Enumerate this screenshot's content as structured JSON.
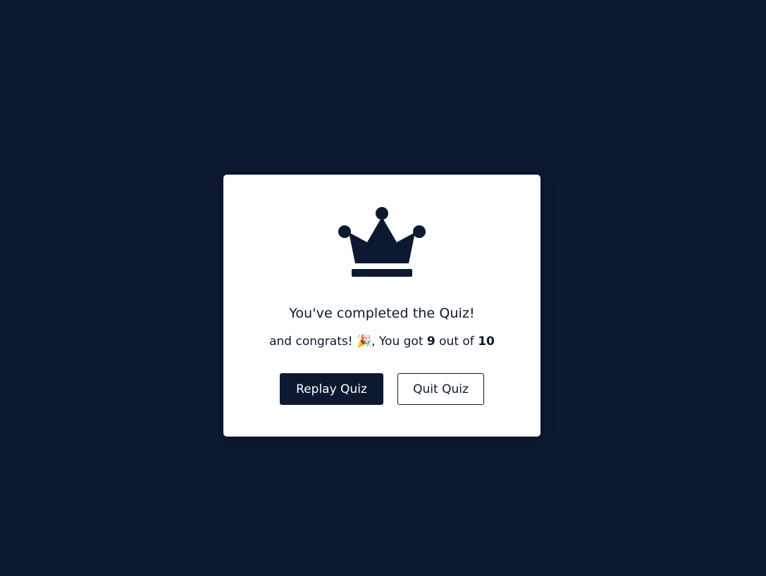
{
  "result": {
    "complete_text": "You've completed the Quiz!",
    "congrats_prefix": "and congrats! 🎉, You got ",
    "score": "9",
    "out_of_text": " out of ",
    "total": "10"
  },
  "buttons": {
    "replay_label": "Replay Quiz",
    "quit_label": "Quit Quiz"
  },
  "icons": {
    "crown": "crown-icon"
  },
  "colors": {
    "background": "#0c1930",
    "card": "#ffffff",
    "accent": "#0c1930"
  }
}
